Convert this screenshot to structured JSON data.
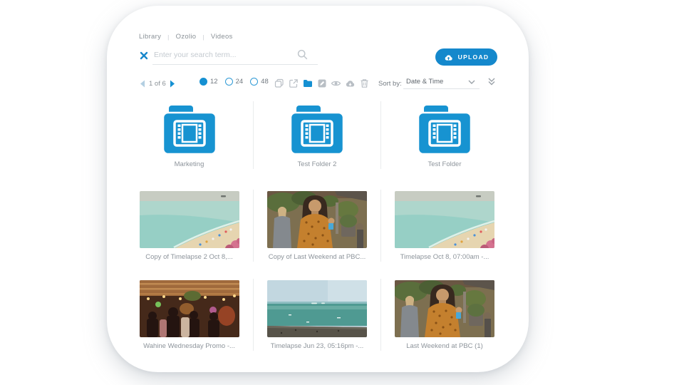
{
  "breadcrumb": {
    "items": [
      "Library",
      "Ozolio",
      "Videos"
    ],
    "separator": "|"
  },
  "search": {
    "placeholder": "Enter your search term...",
    "clear_icon": "x-icon",
    "search_icon": "magnifier-icon"
  },
  "upload_button": {
    "label": "UPLOAD",
    "icon": "cloud-upload-icon"
  },
  "toolbar": {
    "pagination": {
      "text": "1 of 6",
      "prev_icon": "left-arrow-icon",
      "next_icon": "right-arrow-icon"
    },
    "page_size": {
      "options": [
        {
          "label": "12",
          "selected": true
        },
        {
          "label": "24",
          "selected": false
        },
        {
          "label": "48",
          "selected": false
        }
      ]
    },
    "action_icons": [
      "duplicate-icon",
      "open-in-new-icon",
      "folder-icon",
      "edit-icon",
      "eye-icon",
      "cloud-download-icon",
      "trash-icon"
    ],
    "sort": {
      "label": "Sort by:",
      "value": "Date & Time"
    }
  },
  "folders": [
    {
      "label": "Marketing"
    },
    {
      "label": "Test Folder 2"
    },
    {
      "label": "Test Folder"
    }
  ],
  "videos": [
    {
      "label": "Copy of Timelapse 2 Oct 8,..."
    },
    {
      "label": "Copy of Last Weekend at PBC..."
    },
    {
      "label": "Timelapse Oct 8, 07:00am -..."
    },
    {
      "label": "Wahine Wednesday Promo -..."
    },
    {
      "label": "Timelapse Jun 23, 05:16pm -..."
    },
    {
      "label": "Last Weekend at PBC (1)"
    }
  ],
  "colors": {
    "accent": "#1590d2",
    "upload_blue": "#1488cc",
    "icon_gray": "#b9bfc5",
    "text_gray": "#8d949b"
  }
}
